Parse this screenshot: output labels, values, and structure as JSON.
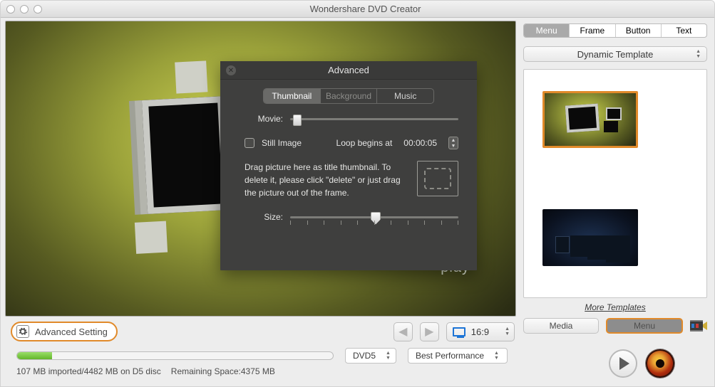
{
  "title": "Wondershare DVD Creator",
  "stage": {
    "play_label": "play"
  },
  "popover": {
    "title": "Advanced",
    "tabs": {
      "thumbnail": "Thumbnail",
      "background": "Background",
      "music": "Music"
    },
    "movie_label": "Movie:",
    "still_label": "Still Image",
    "loop_label": "Loop begins at",
    "loop_value": "00:00:05",
    "drop_text": "Drag picture here as title thumbnail. To delete it, please click \"delete\" or just drag the picture out of the frame.",
    "size_label": "Size:"
  },
  "controls": {
    "advanced": "Advanced Setting",
    "aspect": "16:9"
  },
  "progress": {
    "disc_type": "DVD5",
    "quality": "Best Performance",
    "status_a": "107 MB imported/4482 MB on D5 disc",
    "status_b": "Remaining Space:4375 MB"
  },
  "right": {
    "tabs": {
      "menu": "Menu",
      "frame": "Frame",
      "button": "Button",
      "text": "Text"
    },
    "template_select": "Dynamic Template",
    "more": "More Templates",
    "media": "Media",
    "menu_btn": "Menu"
  }
}
